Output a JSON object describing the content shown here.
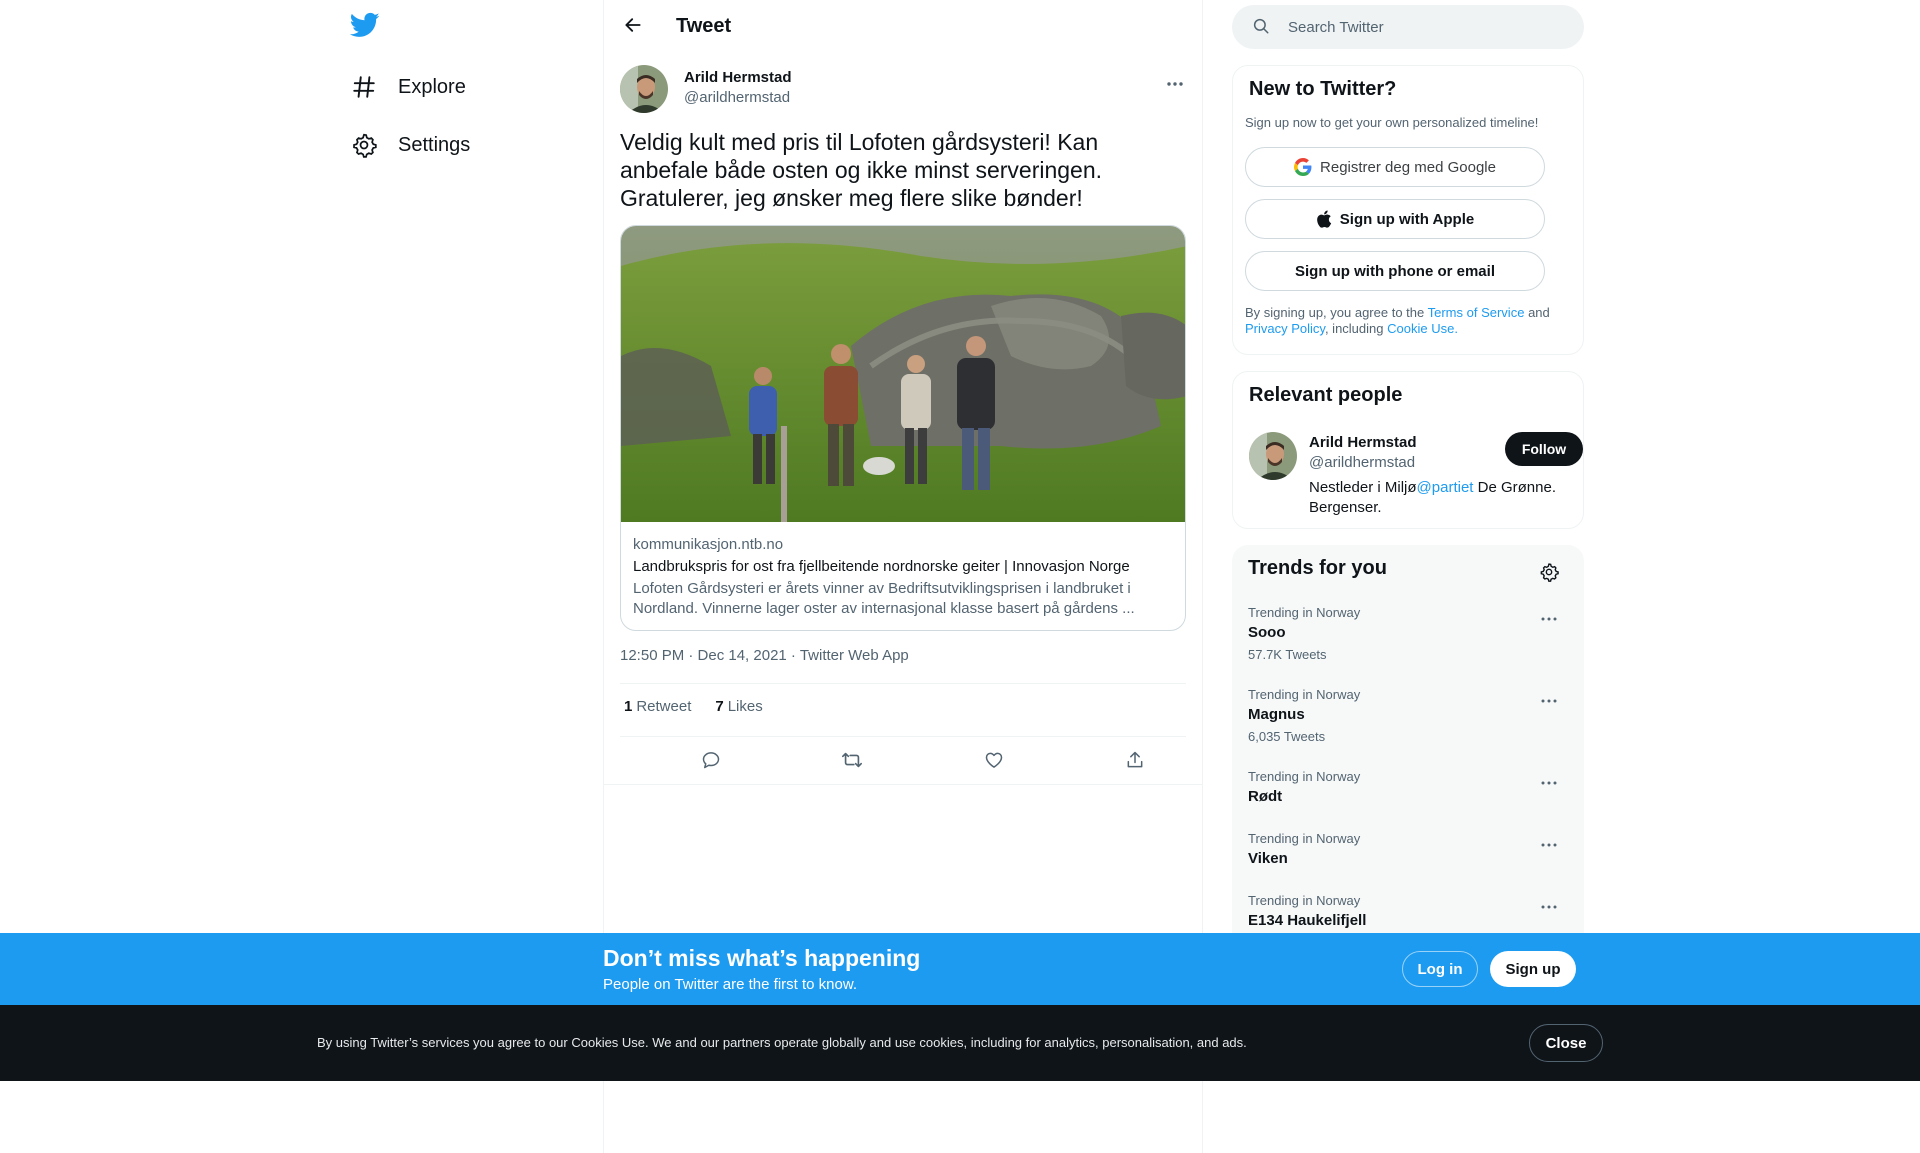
{
  "nav": {
    "logo": "twitter-bird-icon",
    "items": [
      {
        "label": "Explore",
        "icon": "hashtag-icon"
      },
      {
        "label": "Settings",
        "icon": "gear-icon"
      }
    ]
  },
  "header": {
    "title": "Tweet",
    "back_icon": "arrow-left-icon"
  },
  "tweet": {
    "author_name": "Arild Hermstad",
    "author_handle": "@arildhermstad",
    "text": "Veldig kult med pris til Lofoten gårdsysteri! Kan anbefale både osten og ikke minst serveringen. Gratulerer, jeg ønsker meg flere slike bønder!",
    "card": {
      "domain": "kommunikasjon.ntb.no",
      "title": "Landbrukspris for ost fra fjellbeitende nordnorske geiter | Innovasjon Norge",
      "description": "Lofoten Gårdsysteri er årets vinner av Bedriftsutviklingsprisen i landbruket i Nordland. Vinnerne lager oster av internasjonal klasse basert på gårdens ..."
    },
    "timestamp": "12:50 PM · Dec 14, 2021 · Twitter Web App",
    "retweets_count": "1",
    "retweets_label": "Retweet",
    "likes_count": "7",
    "likes_label": "Likes"
  },
  "search": {
    "placeholder": "Search Twitter"
  },
  "new_to_twitter": {
    "title": "New to Twitter?",
    "subtitle": "Sign up now to get your own personalized timeline!",
    "google_label": "Registrer deg med Google",
    "apple_label": "Sign up with Apple",
    "phone_label": "Sign up with phone or email",
    "legal_prefix": "By signing up, you agree to the",
    "terms_link": "Terms of Service",
    "and": "and",
    "privacy_link": "Privacy Policy",
    "including": ", including",
    "cookie_link": "Cookie Use."
  },
  "relevant_people": {
    "title": "Relevant people",
    "name": "Arild Hermstad",
    "handle": "@arildhermstad",
    "follow_label": "Follow",
    "bio_prefix": "Nestleder i Miljø",
    "bio_mention": "@partiet",
    "bio_suffix": " De Grønne. Bergenser."
  },
  "trends": {
    "title": "Trends for you",
    "items": [
      {
        "context": "Trending in Norway",
        "name": "Sooo",
        "count": "57.7K Tweets"
      },
      {
        "context": "Trending in Norway",
        "name": "Magnus",
        "count": "6,035 Tweets"
      },
      {
        "context": "Trending in Norway",
        "name": "Rødt",
        "count": ""
      },
      {
        "context": "Trending in Norway",
        "name": "Viken",
        "count": ""
      },
      {
        "context": "Trending in Norway",
        "name": "E134 Haukelifjell",
        "count": ""
      }
    ]
  },
  "banner": {
    "title": "Don’t miss what’s happening",
    "subtitle": "People on Twitter are the first to know.",
    "login_label": "Log in",
    "signup_label": "Sign up"
  },
  "cookie_bar": {
    "text": "By using Twitter’s services you agree to our Cookies Use. We and our partners operate globally and use cookies, including for analytics, personalisation, and ads.",
    "close_label": "Close"
  },
  "colors": {
    "brand": "#1d9bf0",
    "text": "#0f1419",
    "muted": "#536471",
    "dark": "#0f1419"
  }
}
